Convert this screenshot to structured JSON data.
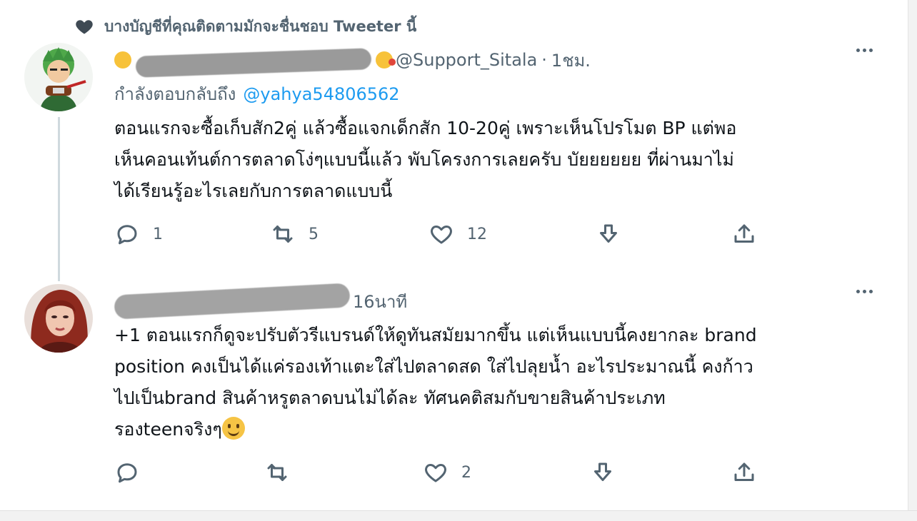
{
  "social_context": {
    "icon": "heart-icon",
    "text": "บางบัญชีที่คุณติดตามมักจะชื่นชอบ Tweeter นี้"
  },
  "tweets": [
    {
      "handle": "@Support_Sitala",
      "separator": "·",
      "time": "1ชม.",
      "reply_label": "กำลังตอบกลับถึง",
      "reply_mention": "@yahya54806562",
      "text": "ตอนแรกจะซื้อเก็บสัก2คู่ แล้วซื้อแจกเด็กสัก 10-20คู่ เพราะเห็นโปรโมต BP แต่พอ\nเห็นคอนเท้นต์การตลาดโง่ๆแบบนี้แล้ว พับโครงการเลยครับ บัยยยยยย ที่ผ่านมาไม่\nได้เรียนรู้อะไรเลยกับการตลาดแบบนี้",
      "actions": {
        "reply_count": "1",
        "retweet_count": "5",
        "like_count": "12"
      }
    },
    {
      "time": "16นาที",
      "text": "+1 ตอนแรกก็ดูจะปรับตัวรีแบรนด์ให้ดูทันสมัยมากขึ้น แต่เห็นแบบนี้คงยากละ brand\nposition คงเป็นได้แค่รองเท้าแตะใส่ไปตลาดสด ใส่ไปลุยน้ำ อะไรประมาณนี้ คงก้าว\nไปเป็นbrand สินค้าหรูตลาดบนไม่ได้ละ ทัศนคติสมกับขายสินค้าประเภท\nรองteenจริงๆ",
      "text_emoji": "slightly-smiling-face",
      "actions": {
        "reply_count": "",
        "retweet_count": "",
        "like_count": "2"
      }
    }
  ],
  "icons": {
    "reply": "reply-icon",
    "retweet": "retweet-icon",
    "like": "like-icon",
    "down": "download-icon",
    "share": "share-icon",
    "more": "more-icon"
  },
  "colors": {
    "text": "#0f1419",
    "muted": "#536471",
    "link": "#1d9bf0",
    "thread_line": "#cfd9de"
  }
}
